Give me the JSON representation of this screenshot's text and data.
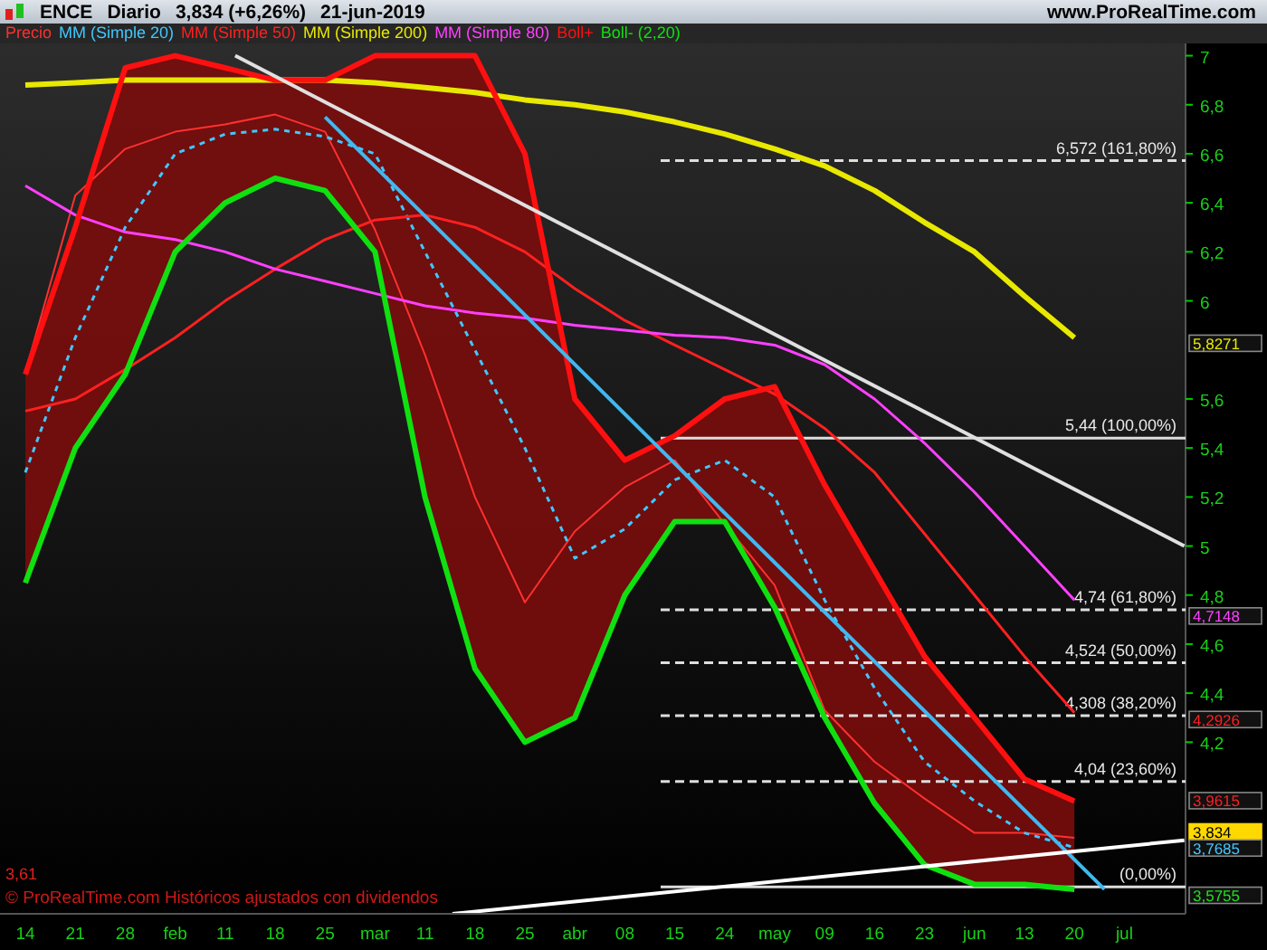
{
  "header": {
    "symbol": "ENCE",
    "period": "Diario",
    "quote": "3,834 (+6,26%)",
    "date": "21-jun-2019",
    "site": "www.ProRealTime.com"
  },
  "chart": {
    "footer_note": "© ProRealTime.com  Históricos ajustados con dividendos",
    "low_label": "3,61",
    "chart_data": {
      "type": "line",
      "categories": [
        "14",
        "21",
        "28",
        "feb",
        "11",
        "18",
        "25",
        "mar",
        "11",
        "18",
        "25",
        "abr",
        "08",
        "15",
        "24",
        "may",
        "09",
        "16",
        "23",
        "jun",
        "13",
        "20",
        "jul"
      ],
      "ylim": [
        3.5,
        7.05
      ],
      "yticks": [
        {
          "value": 7,
          "label": "7"
        },
        {
          "value": 6.8,
          "label": "6,8"
        },
        {
          "value": 6.6,
          "label": "6,6"
        },
        {
          "value": 6.4,
          "label": "6,4"
        },
        {
          "value": 6.2,
          "label": "6,2"
        },
        {
          "value": 6,
          "label": "6"
        },
        {
          "value": 5.6,
          "label": "5,6"
        },
        {
          "value": 5.4,
          "label": "5,4"
        },
        {
          "value": 5.2,
          "label": "5,2"
        },
        {
          "value": 5,
          "label": "5"
        },
        {
          "value": 4.8,
          "label": "4,8"
        },
        {
          "value": 4.6,
          "label": "4,6"
        },
        {
          "value": 4.4,
          "label": "4,4"
        },
        {
          "value": 4.2,
          "label": "4,2"
        }
      ],
      "series": [
        {
          "name": "Precio",
          "color": "#ff3030",
          "values": [
            5.71,
            6.43,
            6.62,
            6.69,
            6.72,
            6.76,
            6.69,
            6.29,
            5.78,
            5.2,
            4.77,
            5.06,
            5.24,
            5.35,
            5.09,
            4.84,
            4.33,
            4.12,
            3.97,
            3.83,
            3.83,
            3.81,
            null
          ]
        },
        {
          "name": "MM (Simple 20)",
          "color": "#40c8ff",
          "line_style": "dashed",
          "values": [
            5.3,
            5.85,
            6.3,
            6.6,
            6.68,
            6.7,
            6.67,
            6.6,
            6.2,
            5.8,
            5.4,
            4.95,
            5.07,
            5.27,
            5.35,
            5.2,
            4.78,
            4.42,
            4.12,
            3.96,
            3.83,
            3.77,
            null
          ]
        },
        {
          "name": "MM (Simple 50)",
          "color": "#ff2020",
          "values": [
            5.55,
            5.6,
            5.72,
            5.85,
            6.0,
            6.13,
            6.25,
            6.33,
            6.35,
            6.3,
            6.2,
            6.05,
            5.92,
            5.82,
            5.72,
            5.62,
            5.48,
            5.3,
            5.05,
            4.8,
            4.55,
            4.32,
            null
          ]
        },
        {
          "name": "MM (Simple 200)",
          "color": "#e8e800",
          "values": [
            6.88,
            6.89,
            6.9,
            6.9,
            6.9,
            6.9,
            6.9,
            6.89,
            6.87,
            6.85,
            6.82,
            6.8,
            6.77,
            6.73,
            6.68,
            6.62,
            6.55,
            6.45,
            6.32,
            6.2,
            6.02,
            5.85,
            null
          ]
        },
        {
          "name": "MM (Simple 80)",
          "color": "#ff40ff",
          "values": [
            6.47,
            6.35,
            6.28,
            6.25,
            6.2,
            6.13,
            6.08,
            6.03,
            5.98,
            5.95,
            5.93,
            5.9,
            5.88,
            5.86,
            5.85,
            5.82,
            5.74,
            5.6,
            5.42,
            5.22,
            5.0,
            4.78,
            null
          ]
        },
        {
          "name": "Boll+",
          "color": "#ff1010",
          "values": [
            5.7,
            6.3,
            6.95,
            7.0,
            6.95,
            6.9,
            6.9,
            7.0,
            7.0,
            7.0,
            6.6,
            5.6,
            5.35,
            5.45,
            5.6,
            5.65,
            5.25,
            4.9,
            4.55,
            4.3,
            4.05,
            3.96,
            null
          ]
        },
        {
          "name": "Boll- (2,20)",
          "color": "#10e010",
          "values": [
            4.85,
            5.4,
            5.7,
            6.2,
            6.4,
            6.5,
            6.45,
            6.2,
            5.2,
            4.5,
            4.2,
            4.3,
            4.8,
            5.1,
            5.1,
            4.75,
            4.3,
            3.95,
            3.7,
            3.62,
            3.62,
            3.6,
            null
          ]
        }
      ],
      "stacked": false
    },
    "fib_levels": [
      {
        "label": "6,572 (161,80%)",
        "dashed": true
      },
      {
        "label": "5,44 (100,00%)",
        "dashed": false
      },
      {
        "label": "4,74 (61,80%)",
        "dashed": true
      },
      {
        "label": "4,524 (50,00%)",
        "dashed": true
      },
      {
        "label": "4,308 (38,20%)",
        "dashed": true
      },
      {
        "label": "4,04 (23,60%)",
        "dashed": true
      },
      {
        "label": "(0,00%)",
        "dashed": false
      }
    ],
    "trendlines": [
      {
        "color": "#e0e0e0"
      },
      {
        "color": "#40b8f0"
      },
      {
        "color": "#ffffff"
      }
    ],
    "price_tags": [
      {
        "label": "5,8271",
        "color": "#e8e800",
        "filled": false
      },
      {
        "label": "4,7148",
        "color": "#ff40ff",
        "filled": false
      },
      {
        "label": "4,2926",
        "color": "#ff2020",
        "filled": false
      },
      {
        "label": "3,9615",
        "color": "#ff2020",
        "filled": false
      },
      {
        "label": "3,834",
        "color": "#ffd800",
        "filled": true
      },
      {
        "label": "3,7685",
        "color": "#40c8ff",
        "filled": false
      },
      {
        "label": "3,5755",
        "color": "#20e020",
        "filled": false
      }
    ]
  }
}
